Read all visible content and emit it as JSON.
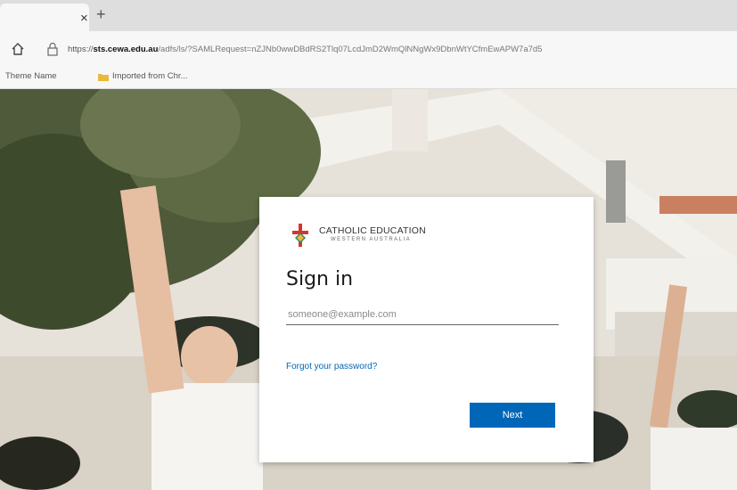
{
  "browser": {
    "tab_close": "×",
    "new_tab": "+",
    "address": {
      "protocol": "https://",
      "domain": "sts.cewa.edu.au",
      "path": "/adfs/ls/?SAMLRequest=nZJNb0wwDBdRS2Tlq07LcdJmD2WmQlNNgWx9DbnWtYCfmEwAPW7a7d5"
    },
    "bookmarks": [
      {
        "label": "Theme Name"
      },
      {
        "label": "Imported from Chr..."
      }
    ]
  },
  "signin": {
    "logo_title": "CATHOLIC EDUCATION",
    "logo_subtitle": "WESTERN AUSTRALIA",
    "heading": "Sign in",
    "email_placeholder": "someone@example.com",
    "forgot_link": "Forgot your password?",
    "next_button": "Next"
  },
  "colors": {
    "accent": "#0067b8",
    "logo_red": "#d9342b"
  },
  "icons": {
    "home": "home-icon",
    "lock": "lock-icon",
    "folder": "folder-icon",
    "logo": "cross-logo-icon"
  }
}
